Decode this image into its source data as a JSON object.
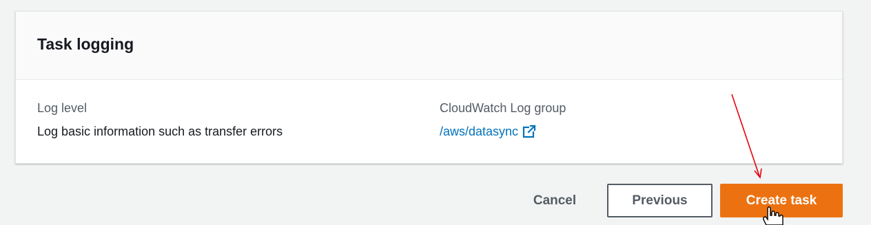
{
  "panel": {
    "title": "Task logging",
    "log_level": {
      "label": "Log level",
      "value": "Log basic information such as transfer errors"
    },
    "log_group": {
      "label": "CloudWatch Log group",
      "link_text": "/aws/datasync",
      "icon": "external-link-icon"
    }
  },
  "actions": {
    "cancel_label": "Cancel",
    "previous_label": "Previous",
    "create_label": "Create task"
  },
  "colors": {
    "primary_button": "#ec7211",
    "link": "#0073bb",
    "annotation_arrow": "#e8000b"
  }
}
